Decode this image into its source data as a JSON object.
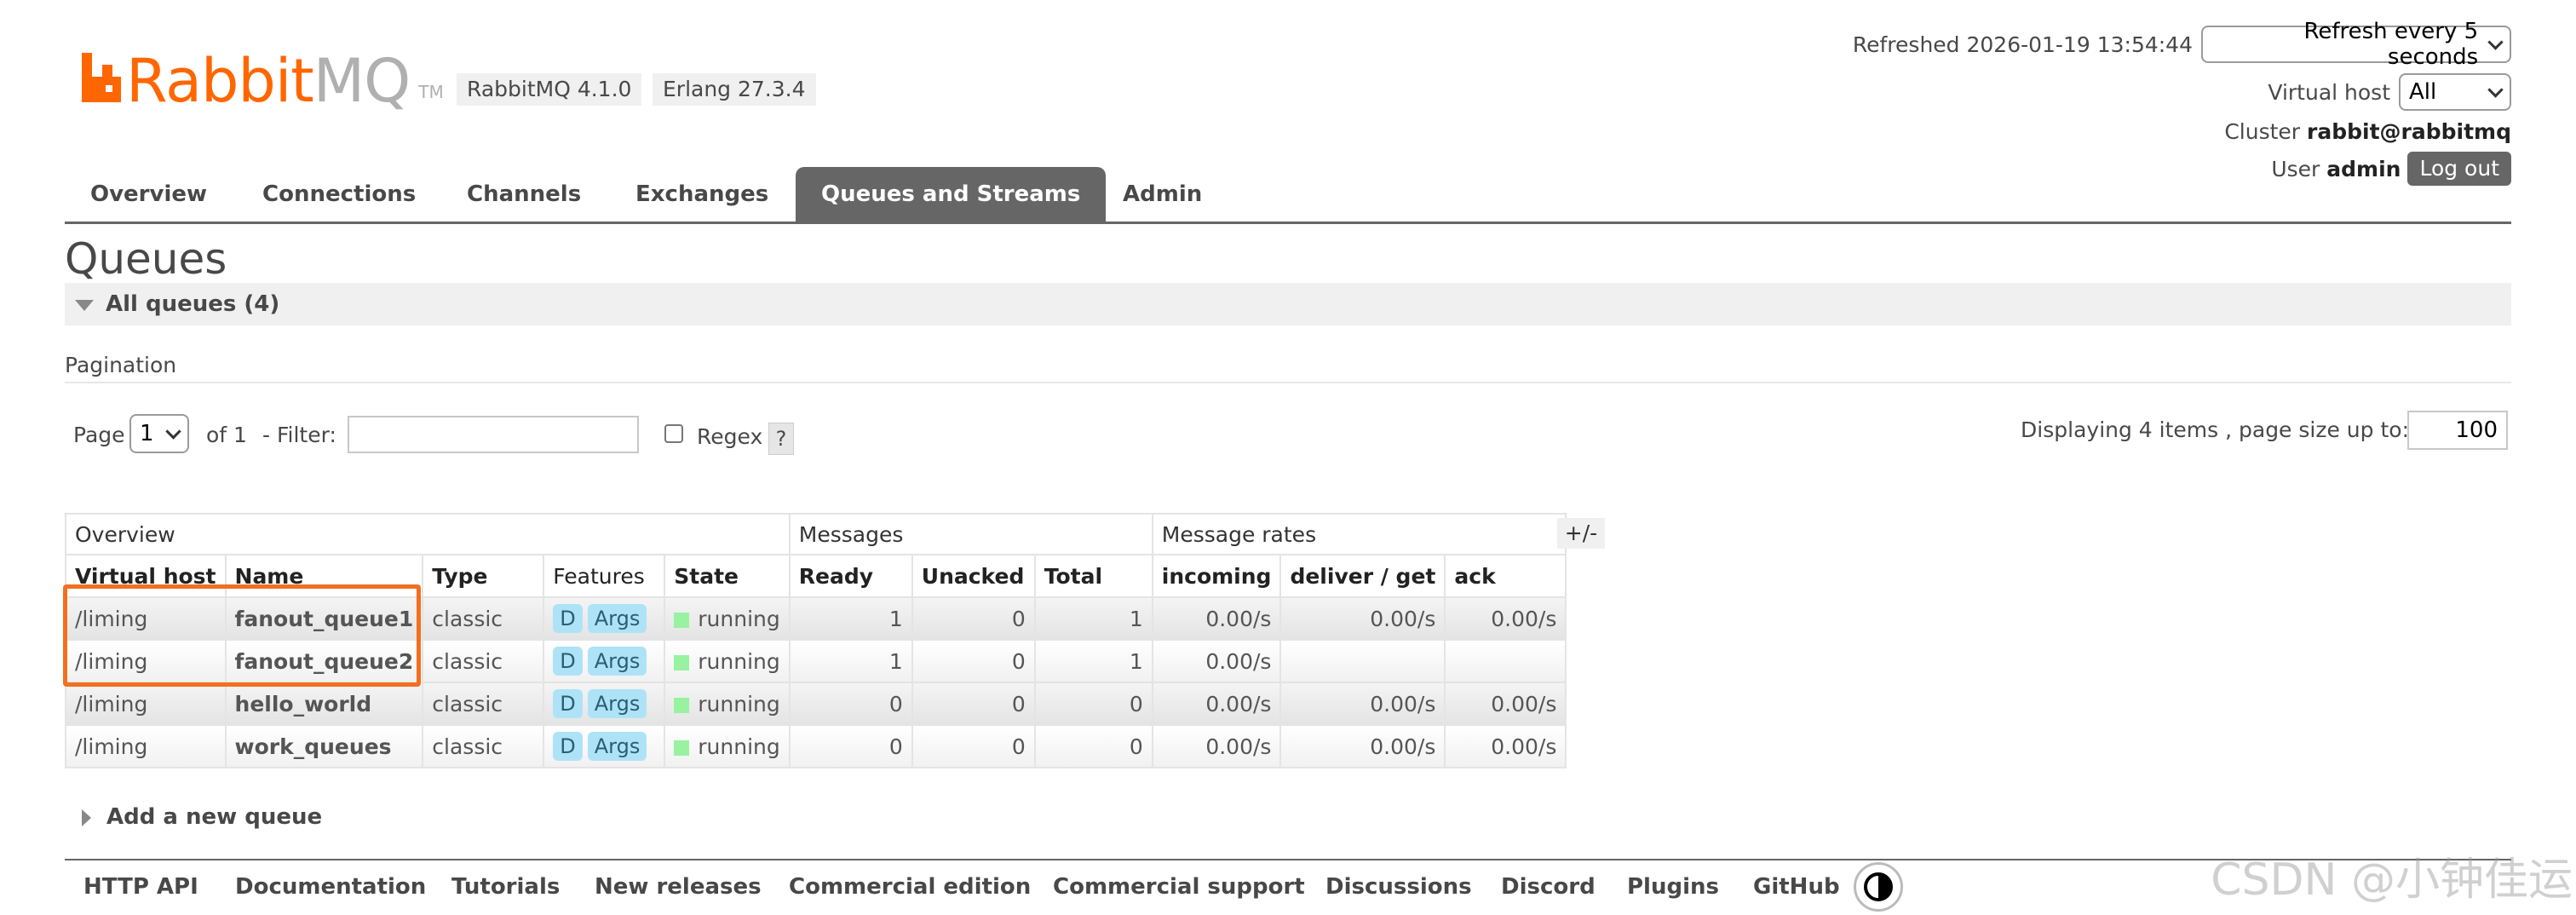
{
  "brand": {
    "name_rabbit": "Rabbit",
    "name_mq": "MQ",
    "tm": "TM",
    "version": "RabbitMQ 4.1.0",
    "erlang": "Erlang 27.3.4"
  },
  "header": {
    "refreshed_label": "Refreshed 2026-01-19 13:54:44",
    "refresh_select": "Refresh every 5 seconds",
    "vhost_label": "Virtual host",
    "vhost_select": "All",
    "cluster_label": "Cluster",
    "cluster_value": "rabbit@rabbitmq",
    "user_label": "User",
    "user_value": "admin",
    "logout": "Log out"
  },
  "tabs": [
    {
      "label": "Overview",
      "active": false
    },
    {
      "label": "Connections",
      "active": false
    },
    {
      "label": "Channels",
      "active": false
    },
    {
      "label": "Exchanges",
      "active": false
    },
    {
      "label": "Queues and Streams",
      "active": true
    },
    {
      "label": "Admin",
      "active": false
    }
  ],
  "page": {
    "title": "Queues",
    "section": "All queues (4)",
    "pagination_label": "Pagination",
    "page_label": "Page",
    "page_value": "1",
    "of_label": "of 1",
    "filter_label": "- Filter:",
    "filter_value": "",
    "regex_label": "Regex",
    "help": "?",
    "displaying": "Displaying 4 items , page size up to:",
    "page_size": "100",
    "plus_minus": "+/-",
    "add_queue": "Add a new queue"
  },
  "table": {
    "groups": [
      "Overview",
      "Messages",
      "Message rates"
    ],
    "columns": [
      "Virtual host",
      "Name",
      "Type",
      "Features",
      "State",
      "Ready",
      "Unacked",
      "Total",
      "incoming",
      "deliver / get",
      "ack"
    ],
    "rows": [
      {
        "vhost": "/liming",
        "name": "fanout_queue1",
        "type": "classic",
        "f1": "D",
        "f2": "Args",
        "state": "running",
        "ready": "1",
        "unacked": "0",
        "total": "1",
        "incoming": "0.00/s",
        "deliver": "0.00/s",
        "ack": "0.00/s"
      },
      {
        "vhost": "/liming",
        "name": "fanout_queue2",
        "type": "classic",
        "f1": "D",
        "f2": "Args",
        "state": "running",
        "ready": "1",
        "unacked": "0",
        "total": "1",
        "incoming": "0.00/s",
        "deliver": "",
        "ack": ""
      },
      {
        "vhost": "/liming",
        "name": "hello_world",
        "type": "classic",
        "f1": "D",
        "f2": "Args",
        "state": "running",
        "ready": "0",
        "unacked": "0",
        "total": "0",
        "incoming": "0.00/s",
        "deliver": "0.00/s",
        "ack": "0.00/s"
      },
      {
        "vhost": "/liming",
        "name": "work_queues",
        "type": "classic",
        "f1": "D",
        "f2": "Args",
        "state": "running",
        "ready": "0",
        "unacked": "0",
        "total": "0",
        "incoming": "0.00/s",
        "deliver": "0.00/s",
        "ack": "0.00/s"
      }
    ]
  },
  "footer": [
    "HTTP API",
    "Documentation",
    "Tutorials",
    "New releases",
    "Commercial edition",
    "Commercial support",
    "Discussions",
    "Discord",
    "Plugins",
    "GitHub"
  ],
  "watermark": "CSDN @小钟佳运",
  "colors": {
    "brand_orange": "#ff6600",
    "highlight": "#f36f1f",
    "tab_active": "#666666",
    "feature_tag": "#aee3f7",
    "running": "#98f2a0"
  }
}
